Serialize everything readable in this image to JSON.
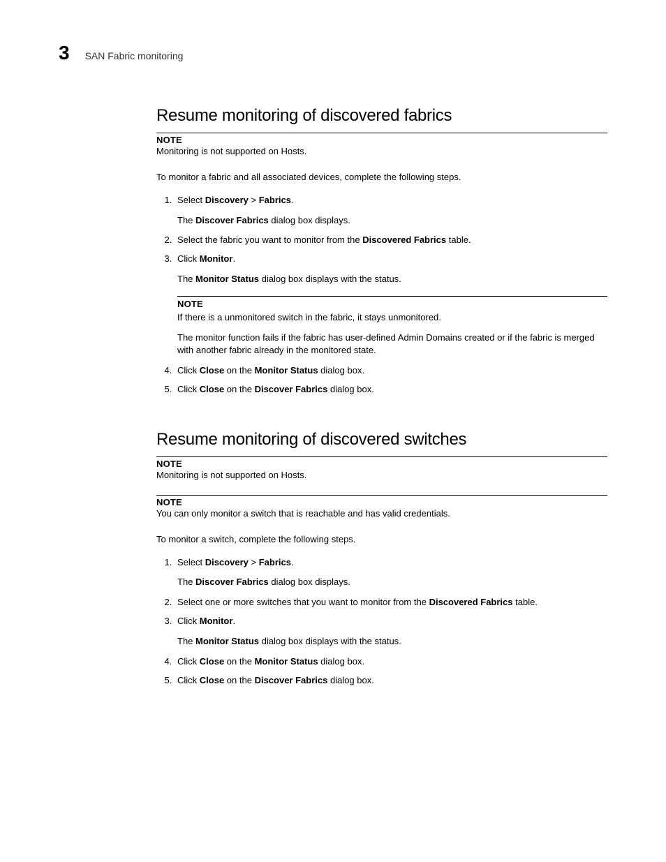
{
  "header": {
    "chapter": "3",
    "running_title": "SAN Fabric monitoring"
  },
  "section1": {
    "heading": "Resume monitoring of discovered fabrics",
    "note_label": "NOTE",
    "note_text": "Monitoring is not supported on Hosts.",
    "intro": "To monitor a fabric and all associated devices, complete the following steps.",
    "step1_prefix": "Select ",
    "step1_b1": "Discovery",
    "step1_mid": " > ",
    "step1_b2": "Fabrics",
    "step1_suffix": ".",
    "step1_body_pre": "The ",
    "step1_body_b": "Discover Fabrics",
    "step1_body_post": " dialog box displays.",
    "step2_pre": "Select the fabric you want to monitor from the ",
    "step2_b": "Discovered Fabrics",
    "step2_post": " table.",
    "step3_pre": "Click ",
    "step3_b": "Monitor",
    "step3_post": ".",
    "step3_body_pre": "The ",
    "step3_body_b": "Monitor Status",
    "step3_body_post": " dialog box displays with the status.",
    "inner_note_label": "NOTE",
    "inner_note_text": "If there is a unmonitored switch in the fabric, it stays unmonitored.",
    "step3_extra": "The monitor function fails if the fabric has user-defined Admin Domains created or if the fabric is merged with another fabric already in the monitored state.",
    "step4_pre": "Click ",
    "step4_b1": "Close",
    "step4_mid": " on the ",
    "step4_b2": "Monitor Status",
    "step4_post": " dialog box.",
    "step5_pre": "Click ",
    "step5_b1": "Close",
    "step5_mid": " on the ",
    "step5_b2": "Discover Fabrics",
    "step5_post": " dialog box."
  },
  "section2": {
    "heading": "Resume monitoring of discovered switches",
    "note1_label": "NOTE",
    "note1_text": "Monitoring is not supported on Hosts.",
    "note2_label": "NOTE",
    "note2_text": "You can only monitor a switch that is reachable and has valid credentials.",
    "intro": "To monitor a switch, complete the following steps.",
    "step1_prefix": "Select ",
    "step1_b1": "Discovery",
    "step1_mid": " > ",
    "step1_b2": "Fabrics",
    "step1_suffix": ".",
    "step1_body_pre": "The ",
    "step1_body_b": "Discover Fabrics",
    "step1_body_post": " dialog box displays.",
    "step2_pre": "Select one or more switches that you want to monitor from the ",
    "step2_b": "Discovered Fabrics",
    "step2_post": " table.",
    "step3_pre": "Click ",
    "step3_b": "Monitor",
    "step3_post": ".",
    "step3_body_pre": "The ",
    "step3_body_b": "Monitor Status",
    "step3_body_post": " dialog box displays with the status.",
    "step4_pre": "Click ",
    "step4_b1": "Close",
    "step4_mid": " on the ",
    "step4_b2": "Monitor Status",
    "step4_post": " dialog box.",
    "step5_pre": "Click ",
    "step5_b1": "Close",
    "step5_mid": " on the ",
    "step5_b2": "Discover Fabrics",
    "step5_post": " dialog box."
  }
}
